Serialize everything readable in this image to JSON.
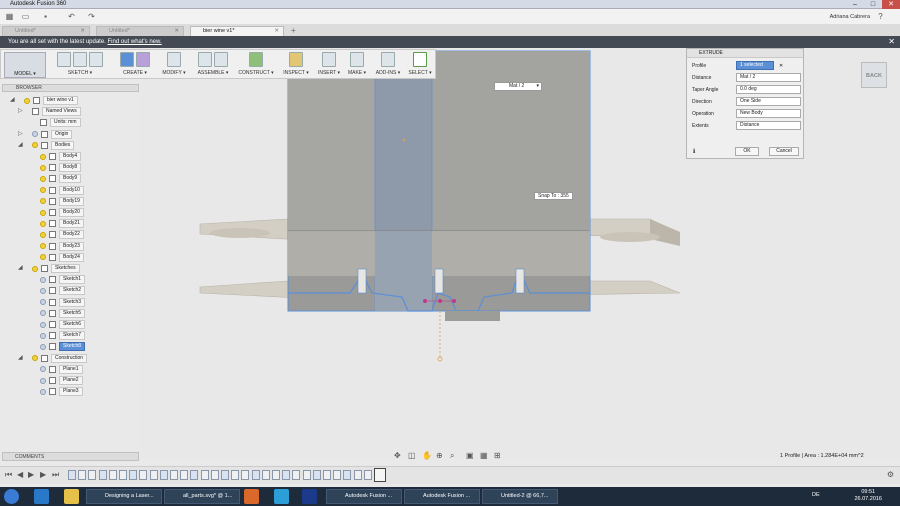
{
  "window": {
    "title": "Autodesk Fusion 360",
    "min": "–",
    "max": "□",
    "close": "✕"
  },
  "user": {
    "name": "Adriana Cabrera"
  },
  "tabs": [
    {
      "label": "Untitled*"
    },
    {
      "label": "Untitled*"
    },
    {
      "label": "bier wine v1*"
    }
  ],
  "banner": {
    "text": "You are all set with the latest update.",
    "link": "Find out what's new."
  },
  "ribbon": {
    "workspace": "MODEL ▾",
    "groups": [
      "SKETCH ▾",
      "CREATE ▾",
      "MODIFY ▾",
      "ASSEMBLE ▾",
      "CONSTRUCT ▾",
      "INSPECT ▾",
      "INSERT ▾",
      "MAKE ▾",
      "ADD-INS ▾",
      "SELECT ▾"
    ]
  },
  "browser": {
    "header": "BROWSER",
    "root": "bier wine v1",
    "named_views": "Named Views",
    "units": "Units: mm",
    "origin": "Origin",
    "bodies": {
      "label": "Bodies",
      "items": [
        "Body4",
        "Body8",
        "Body9",
        "Body10",
        "Body19",
        "Body20",
        "Body21",
        "Body22",
        "Body23",
        "Body24"
      ]
    },
    "sketches": {
      "label": "Sketches",
      "items": [
        "Sketch1",
        "Sketch2",
        "Sketch3",
        "Sketch5",
        "Sketch6",
        "Sketch7",
        "Sketch8"
      ],
      "selected": "Sketch8"
    },
    "construction": {
      "label": "Construction",
      "items": [
        "Plane1",
        "Plane2",
        "Plane3"
      ]
    }
  },
  "canvas": {
    "distance_chip": "Mat / 2",
    "snap_tip": "Snap To : 355"
  },
  "extrude": {
    "title": "EXTRUDE",
    "rows": [
      {
        "label": "Profile",
        "value": "1 selected"
      },
      {
        "label": "Distance",
        "value": "Mat / 2"
      },
      {
        "label": "Taper Angle",
        "value": "0.0 deg"
      },
      {
        "label": "Direction",
        "value": "One Side"
      },
      {
        "label": "Operation",
        "value": "New Body"
      },
      {
        "label": "Extents",
        "value": "Distance"
      }
    ],
    "ok": "OK",
    "cancel": "Cancel"
  },
  "viewcube": {
    "label": "BACK"
  },
  "comments": {
    "label": "COMMENTS"
  },
  "status": {
    "text": "1 Profile | Area : 1.284E+04 mm^2"
  },
  "taskbar": {
    "apps": [
      "Designing a Laser...",
      "all_parts.svg* @ 1...",
      "Autodesk Fusion ...",
      "Autodesk Fusion ...",
      "Untitled-2 @ 66,7..."
    ],
    "lang": "DE",
    "time": "09:51",
    "date": "26.07.2016"
  }
}
